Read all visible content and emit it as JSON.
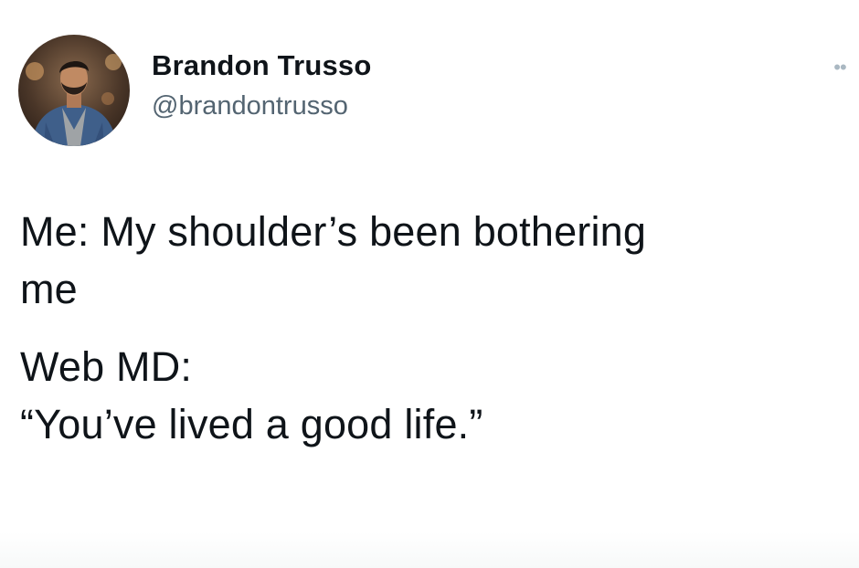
{
  "tweet": {
    "author": {
      "display_name": "Brandon Trusso",
      "handle": "@brandontrusso",
      "avatar_icon": "profile-photo"
    },
    "more_icon": "more-options-icon",
    "text": {
      "paragraph_1": {
        "line_1": "Me: My shoulder’s been bothering",
        "line_2": "me"
      },
      "paragraph_2": {
        "line_1": "Web MD:",
        "line_2": "“You’ve lived a good life.”"
      }
    }
  }
}
